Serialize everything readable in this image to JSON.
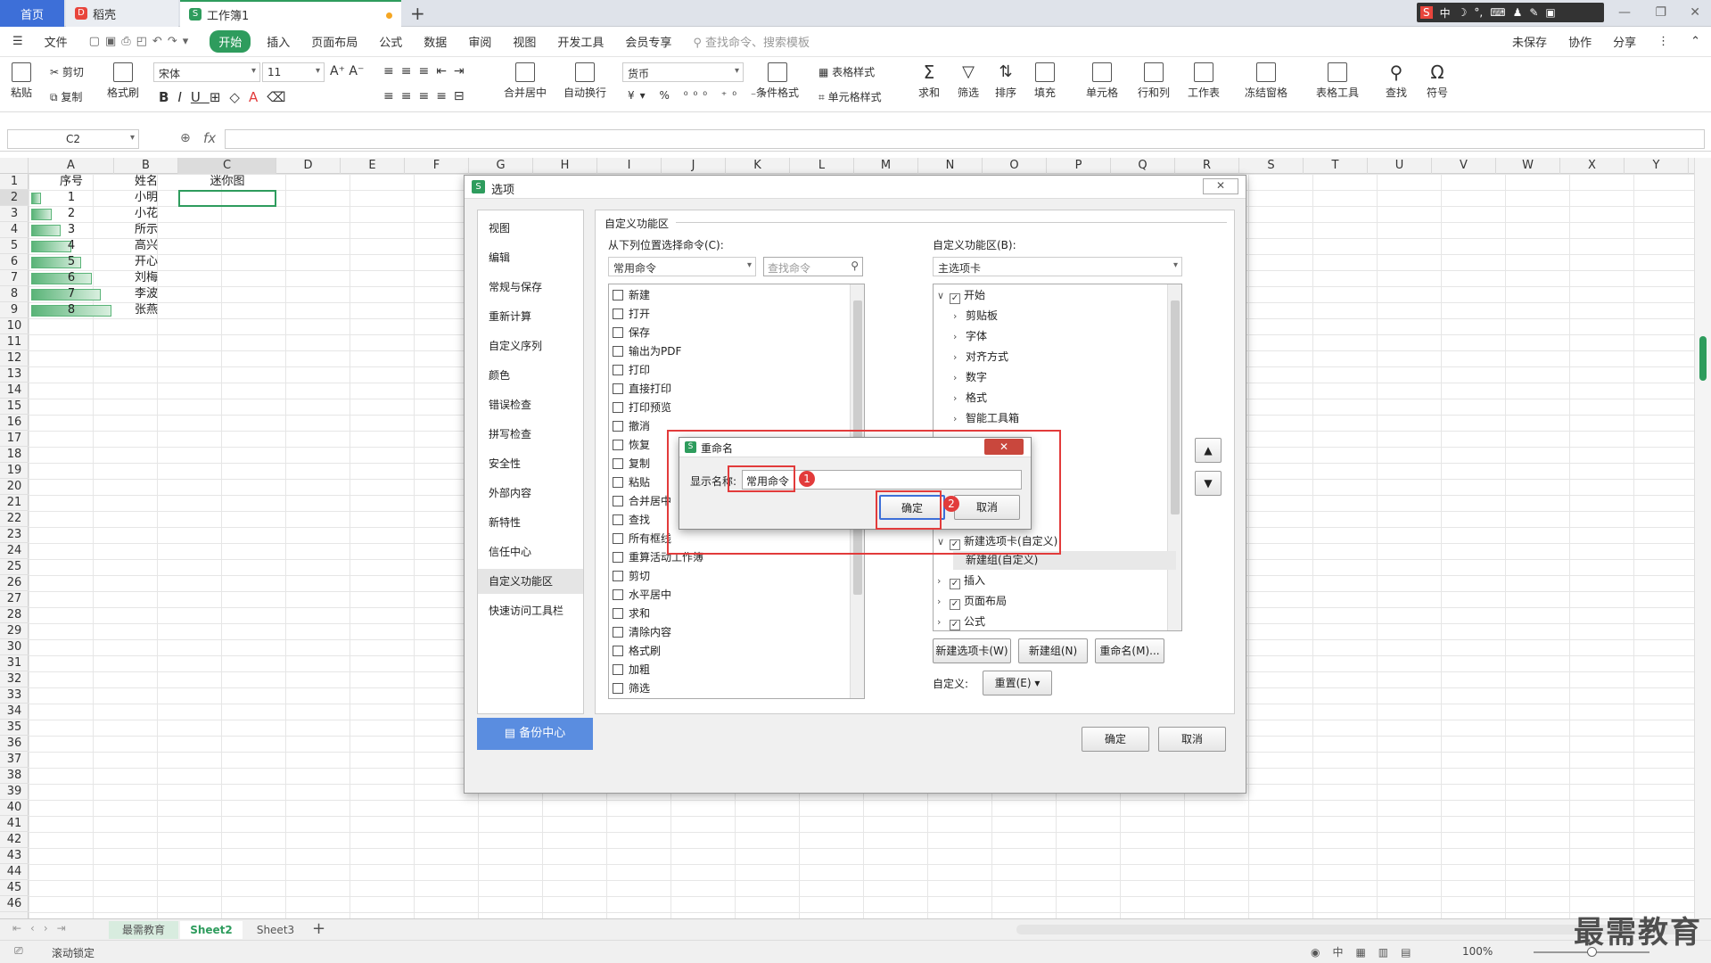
{
  "tabs": {
    "home": "首页",
    "docer": "稻壳",
    "workbook": "工作簿1"
  },
  "menu": [
    "文件",
    "开始",
    "插入",
    "页面布局",
    "公式",
    "数据",
    "审阅",
    "视图",
    "开发工具",
    "会员专享"
  ],
  "menu_search": "查找命令、搜索模板",
  "menu_right": {
    "unsaved": "未保存",
    "collab": "协作",
    "share": "分享"
  },
  "ribbon": {
    "paste": "粘贴",
    "cut": "剪切",
    "copy": "复制",
    "format_painter": "格式刷",
    "font": "宋体",
    "size": "11",
    "merge": "合并居中",
    "wrap": "自动换行",
    "number_format": "货币",
    "cond_format": "条件格式",
    "table_style": "表格样式",
    "cell_style": "单元格样式",
    "sum": "求和",
    "filter": "筛选",
    "sort": "排序",
    "fill": "填充",
    "cell": "单元格",
    "rowcol": "行和列",
    "sheet": "工作表",
    "freeze": "冻结窗格",
    "table_tools": "表格工具",
    "find": "查找",
    "symbol": "符号"
  },
  "namebox": "C2",
  "fx": "fx",
  "columns": [
    "A",
    "B",
    "C",
    "D",
    "E",
    "F",
    "G",
    "H",
    "I",
    "J",
    "K",
    "L",
    "M",
    "N",
    "O",
    "P",
    "Q",
    "R",
    "S",
    "T",
    "U",
    "V",
    "W",
    "X",
    "Y"
  ],
  "rows": [
    "1",
    "2",
    "3",
    "4",
    "5",
    "6",
    "7",
    "8",
    "9",
    "10",
    "11",
    "12",
    "13",
    "14",
    "15",
    "16",
    "17",
    "18",
    "19",
    "20",
    "21",
    "22",
    "23",
    "24",
    "25",
    "26",
    "27",
    "28",
    "29",
    "30",
    "31",
    "32",
    "33",
    "34",
    "35",
    "36",
    "37",
    "38",
    "39",
    "40",
    "41",
    "42",
    "43",
    "44",
    "45",
    "46"
  ],
  "header": {
    "a": "序号",
    "b": "姓名",
    "c": "迷你图"
  },
  "table": [
    {
      "no": "1",
      "name": "小明",
      "bar": 0.12
    },
    {
      "no": "2",
      "name": "小花",
      "bar": 0.25
    },
    {
      "no": "3",
      "name": "所示",
      "bar": 0.37
    },
    {
      "no": "4",
      "name": "高兴",
      "bar": 0.5
    },
    {
      "no": "5",
      "name": "开心",
      "bar": 0.62
    },
    {
      "no": "6",
      "name": "刘梅",
      "bar": 0.75
    },
    {
      "no": "7",
      "name": "李波",
      "bar": 0.87
    },
    {
      "no": "8",
      "name": "张燕",
      "bar": 1.0
    }
  ],
  "sheets": [
    "最需教育",
    "Sheet2",
    "Sheet3"
  ],
  "status": {
    "scroll_lock": "滚动锁定",
    "zoom": "100%"
  },
  "options": {
    "title": "选项",
    "nav": [
      "视图",
      "编辑",
      "常规与保存",
      "重新计算",
      "自定义序列",
      "颜色",
      "错误检查",
      "拼写检查",
      "安全性",
      "外部内容",
      "新特性",
      "信任中心",
      "自定义功能区",
      "快速访问工具栏"
    ],
    "backup": "备份中心",
    "section": "自定义功能区",
    "left_label": "从下列位置选择命令(C):",
    "left_combo": "常用命令",
    "search_placeholder": "查找命令",
    "commands": [
      "新建",
      "打开",
      "保存",
      "输出为PDF",
      "打印",
      "直接打印",
      "打印预览",
      "撤消",
      "恢复",
      "复制",
      "粘贴",
      "合并居中",
      "查找",
      "所有框线",
      "重算活动工作簿",
      "剪切",
      "水平居中",
      "求和",
      "清除内容",
      "格式刷",
      "加粗",
      "筛选"
    ],
    "right_label": "自定义功能区(B):",
    "right_combo": "主选项卡",
    "tree_top": [
      "开始",
      "剪贴板",
      "字体",
      "对齐方式",
      "数字",
      "格式",
      "智能工具箱"
    ],
    "tree_bottom": [
      "新建选项卡(自定义)",
      "新建组(自定义)",
      "插入",
      "页面布局",
      "公式"
    ],
    "btn_new_tab": "新建选项卡(W)",
    "btn_new_group": "新建组(N)",
    "btn_rename": "重命名(M)...",
    "custom_label": "自定义:",
    "reset": "重置(E)",
    "ok": "确定",
    "cancel": "取消"
  },
  "rename": {
    "title": "重命名",
    "label": "显示名称:",
    "value": "常用命令",
    "ok": "确定",
    "cancel": "取消",
    "badge1": "1",
    "badge2": "2"
  },
  "watermark": "最需教育",
  "colors": {
    "accent": "#2e9c5d",
    "home_tab": "#3d6fd8",
    "highlight": "#e23b3b"
  }
}
